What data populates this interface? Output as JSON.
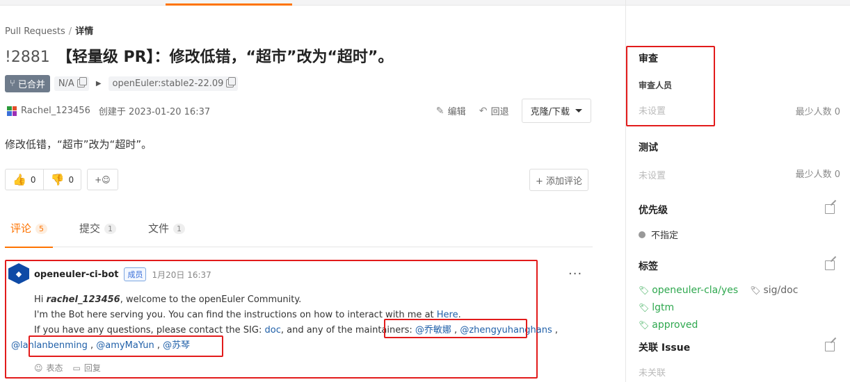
{
  "breadcrumb": {
    "root": "Pull Requests",
    "separator": "/",
    "current": "详情"
  },
  "pr": {
    "number": "!2881",
    "title": "【轻量级 PR】：修改低错，“超市”改为“超时”。",
    "status": "已合并",
    "source_branch": "N/A",
    "target_branch": "openEuler:stable2-22.09",
    "author": "Rachel_123456",
    "created": "创建于 2023-01-20 16:37",
    "description": "修改低错，“超市”改为“超时”。"
  },
  "actions": {
    "edit": "编辑",
    "revert": "回退",
    "clone": "克隆/下载"
  },
  "reactions": {
    "up_count": "0",
    "down_count": "0",
    "add": "+☺"
  },
  "add_comment": "+ 添加评论",
  "tabs": [
    {
      "label": "评论",
      "count": "5"
    },
    {
      "label": "提交",
      "count": "1"
    },
    {
      "label": "文件",
      "count": "1"
    }
  ],
  "comment": {
    "author": "openeuler-ci-bot",
    "role": "成员",
    "time": "1月20日 16:37",
    "more": "···",
    "greeting_prefix": "Hi ",
    "greeting_user": "rachel_123456",
    "greeting_suffix": ", welcome to the openEuler Community.",
    "line2_prefix": "I'm the Bot here serving you. You can find the instructions on how to interact with me at ",
    "line2_link": "Here",
    "line2_suffix": ".",
    "line3_prefix": "If you have any questions, please contact the SIG: ",
    "line3_sig": "doc",
    "line3_mid": ", and any of the maintainers: ",
    "mention1": "@乔敏娜",
    "mention_sep": " , ",
    "mention2": "@zhengyuhanghans",
    "mention_trail": " ,",
    "mention3": "@lanlanbenming",
    "mention4": "@amyMaYun",
    "mention5": "@苏琴",
    "footer_react": "表态",
    "footer_reply": "回复"
  },
  "sidebar": {
    "review": {
      "title": "审查",
      "sub": "审查人员",
      "value": "未设置",
      "min": "最少人数 0"
    },
    "test": {
      "title": "测试",
      "value": "未设置",
      "min": "最少人数 0"
    },
    "priority": {
      "title": "优先级",
      "value": "不指定"
    },
    "labels": {
      "title": "标签",
      "items": [
        {
          "name": "openeuler-cla/yes",
          "color": "#2fa84f"
        },
        {
          "name": "sig/doc",
          "color": "#666666"
        },
        {
          "name": "lgtm",
          "color": "#2fa84f"
        },
        {
          "name": "approved",
          "color": "#2fa84f"
        }
      ]
    },
    "issue": {
      "title": "关联 Issue",
      "value": "未关联"
    }
  },
  "colors": {
    "accent": "#fe7300",
    "highlight": "#e21b1b",
    "link": "#1f5fa8"
  }
}
